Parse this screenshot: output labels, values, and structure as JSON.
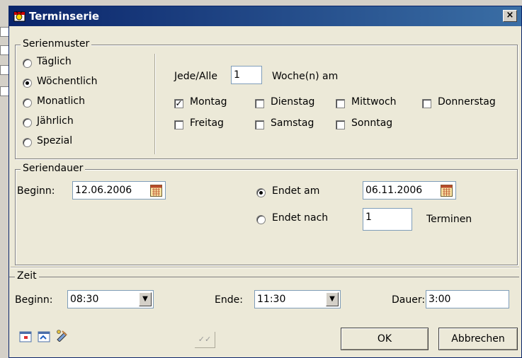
{
  "window": {
    "title": "Terminserie",
    "close_glyph": "×"
  },
  "recurrence": {
    "legend": "Serienmuster",
    "patterns": [
      {
        "label": "Täglich",
        "selected": false
      },
      {
        "label": "Wöchentlich",
        "selected": true
      },
      {
        "label": "Monatlich",
        "selected": false
      },
      {
        "label": "Jährlich",
        "selected": false
      },
      {
        "label": "Spezial",
        "selected": false
      }
    ],
    "every_label": "Jede/Alle",
    "every_value": "1",
    "week_label": "Woche(n) am",
    "days": [
      {
        "label": "Montag",
        "checked": true
      },
      {
        "label": "Dienstag",
        "checked": false
      },
      {
        "label": "Mittwoch",
        "checked": false
      },
      {
        "label": "Donnerstag",
        "checked": false
      },
      {
        "label": "Freitag",
        "checked": false
      },
      {
        "label": "Samstag",
        "checked": false
      },
      {
        "label": "Sonntag",
        "checked": false
      }
    ]
  },
  "duration": {
    "legend": "Seriendauer",
    "start_label": "Beginn:",
    "start_value": "12.06.2006",
    "end_on_label": "Endet am",
    "end_on_value": "06.11.2006",
    "end_on_selected": true,
    "end_after_label": "Endet nach",
    "end_after_value": "1",
    "end_after_unit": "Terminen"
  },
  "time": {
    "legend": "Zeit",
    "start_label": "Beginn:",
    "start_value": "08:30",
    "end_label": "Ende:",
    "end_value": "11:30",
    "duration_label": "Dauer:",
    "duration_value": "3:00"
  },
  "footer": {
    "icons": [
      "calendar-view-icon",
      "calendar-edit-icon",
      "paint-tools-icon"
    ],
    "check_glyph": "✓✓",
    "ok_label": "OK",
    "cancel_label": "Abbrechen"
  },
  "colors": {
    "title_start": "#0a246a",
    "title_end": "#3a6ea5",
    "dialog_bg": "#ece9d8"
  }
}
